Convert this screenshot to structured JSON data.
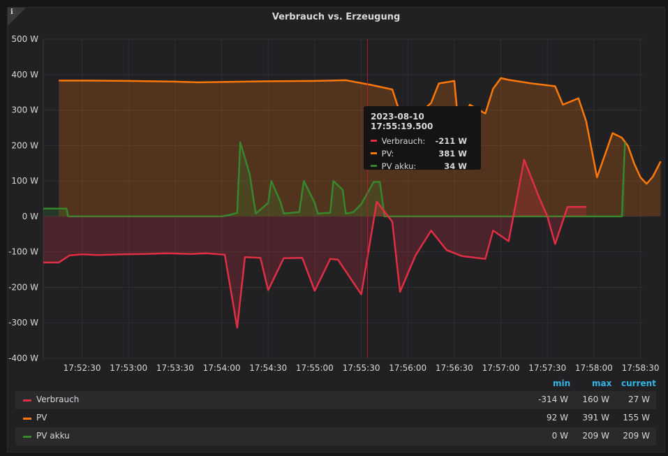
{
  "panel": {
    "info_glyph": "i",
    "title": "Verbrauch vs. Erzeugung"
  },
  "colors": {
    "Verbrauch": "#e02f44",
    "PV": "#ff780a",
    "PV akku": "#37872d",
    "axis_text": "#d8d9da",
    "grid": "#2f2f32",
    "legend_header": "#33b5e5"
  },
  "tooltip": {
    "time": "2023-08-10 17:55:19.500",
    "rows": [
      {
        "name": "Verbrauch:",
        "value": "-211 W",
        "color": "#e02f44"
      },
      {
        "name": "PV:",
        "value": "381 W",
        "color": "#ff780a"
      },
      {
        "name": "PV akku:",
        "value": "34 W",
        "color": "#37872d"
      }
    ]
  },
  "legend": {
    "headers": {
      "min": "min",
      "max": "max",
      "current": "current"
    },
    "rows": [
      {
        "name": "Verbrauch",
        "min": "-314 W",
        "max": "160 W",
        "current": "27 W",
        "color": "#e02f44"
      },
      {
        "name": "PV",
        "min": "92 W",
        "max": "391 W",
        "current": "155 W",
        "color": "#ff780a"
      },
      {
        "name": "PV akku",
        "min": "0 W",
        "max": "209 W",
        "current": "209 W",
        "color": "#37872d"
      }
    ]
  },
  "chart_data": {
    "type": "area",
    "title": "Verbrauch vs. Erzeugung",
    "xlabel": "",
    "ylabel": "",
    "y_unit": "W",
    "ylim": [
      -400,
      500
    ],
    "y_ticks": [
      500,
      400,
      300,
      200,
      100,
      0,
      -100,
      -200,
      -300,
      -400
    ],
    "y_tick_labels": [
      "500 W",
      "400 W",
      "300 W",
      "200 W",
      "100 W",
      "0 W",
      "-100 W",
      "-200 W",
      "-300 W",
      "-400 W"
    ],
    "xlim": [
      "17:52:05",
      "17:58:32"
    ],
    "x_ticks": [
      "17:52:30",
      "17:53:00",
      "17:53:30",
      "17:54:00",
      "17:54:30",
      "17:55:00",
      "17:55:30",
      "17:56:00",
      "17:56:30",
      "17:57:00",
      "17:57:30",
      "17:58:00",
      "17:58:30"
    ],
    "grid": true,
    "crosshair_x": "17:55:34",
    "series": [
      {
        "name": "PV",
        "fill": true,
        "points": [
          [
            "17:52:15",
            383
          ],
          [
            "17:52:35",
            383
          ],
          [
            "17:53:00",
            382
          ],
          [
            "17:53:30",
            380
          ],
          [
            "17:53:45",
            378
          ],
          [
            "17:54:00",
            379
          ],
          [
            "17:54:30",
            381
          ],
          [
            "17:55:00",
            382
          ],
          [
            "17:55:20",
            384
          ],
          [
            "17:55:35",
            372
          ],
          [
            "17:55:50",
            358
          ],
          [
            "17:56:00",
            225
          ],
          [
            "17:56:10",
            300
          ],
          [
            "17:56:15",
            320
          ],
          [
            "17:56:20",
            375
          ],
          [
            "17:56:30",
            382
          ],
          [
            "17:56:33",
            240
          ],
          [
            "17:56:40",
            315
          ],
          [
            "17:56:50",
            290
          ],
          [
            "17:56:55",
            360
          ],
          [
            "17:57:00",
            390
          ],
          [
            "17:57:05",
            385
          ],
          [
            "17:57:20",
            375
          ],
          [
            "17:57:35",
            367
          ],
          [
            "17:57:40",
            315
          ],
          [
            "17:57:50",
            333
          ],
          [
            "17:57:55",
            268
          ],
          [
            "17:58:02",
            110
          ],
          [
            "17:58:12",
            235
          ],
          [
            "17:58:18",
            222
          ],
          [
            "17:58:22",
            198
          ],
          [
            "17:58:26",
            148
          ],
          [
            "17:58:30",
            110
          ],
          [
            "17:58:34",
            92
          ],
          [
            "17:58:38",
            112
          ],
          [
            "17:58:43",
            155
          ]
        ]
      },
      {
        "name": "PV akku",
        "fill": true,
        "points": [
          [
            "17:52:05",
            22
          ],
          [
            "17:52:20",
            22
          ],
          [
            "17:52:21",
            0
          ],
          [
            "17:54:00",
            0
          ],
          [
            "17:54:05",
            4
          ],
          [
            "17:54:10",
            10
          ],
          [
            "17:54:12",
            209
          ],
          [
            "17:54:18",
            120
          ],
          [
            "17:54:22",
            8
          ],
          [
            "17:54:30",
            38
          ],
          [
            "17:54:32",
            100
          ],
          [
            "17:54:38",
            40
          ],
          [
            "17:54:40",
            8
          ],
          [
            "17:54:50",
            12
          ],
          [
            "17:54:53",
            100
          ],
          [
            "17:55:00",
            38
          ],
          [
            "17:55:02",
            8
          ],
          [
            "17:55:10",
            10
          ],
          [
            "17:55:12",
            100
          ],
          [
            "17:55:18",
            75
          ],
          [
            "17:55:20",
            8
          ],
          [
            "17:55:25",
            12
          ],
          [
            "17:55:30",
            35
          ],
          [
            "17:55:38",
            97
          ],
          [
            "17:55:42",
            97
          ],
          [
            "17:55:45",
            0
          ],
          [
            "17:58:18",
            0
          ],
          [
            "17:58:20",
            209
          ]
        ]
      },
      {
        "name": "Verbrauch",
        "fill": true,
        "points": [
          [
            "17:52:05",
            -130
          ],
          [
            "17:52:15",
            -130
          ],
          [
            "17:52:22",
            -110
          ],
          [
            "17:52:30",
            -107
          ],
          [
            "17:52:40",
            -109
          ],
          [
            "17:52:55",
            -107
          ],
          [
            "17:53:10",
            -106
          ],
          [
            "17:53:25",
            -104
          ],
          [
            "17:53:40",
            -106
          ],
          [
            "17:53:50",
            -104
          ],
          [
            "17:54:02",
            -108
          ],
          [
            "17:54:10",
            -314
          ],
          [
            "17:54:15",
            -115
          ],
          [
            "17:54:25",
            -117
          ],
          [
            "17:54:30",
            -208
          ],
          [
            "17:54:40",
            -118
          ],
          [
            "17:54:52",
            -117
          ],
          [
            "17:55:00",
            -210
          ],
          [
            "17:55:10",
            -120
          ],
          [
            "17:55:15",
            -122
          ],
          [
            "17:55:30",
            -220
          ],
          [
            "17:55:40",
            42
          ],
          [
            "17:55:50",
            -15
          ],
          [
            "17:55:55",
            -213
          ],
          [
            "17:56:05",
            -110
          ],
          [
            "17:56:15",
            -40
          ],
          [
            "17:56:25",
            -95
          ],
          [
            "17:56:35",
            -112
          ],
          [
            "17:56:50",
            -120
          ],
          [
            "17:56:55",
            -40
          ],
          [
            "17:57:05",
            -70
          ],
          [
            "17:57:15",
            160
          ],
          [
            "17:57:25",
            50
          ],
          [
            "17:57:30",
            0
          ],
          [
            "17:57:35",
            -78
          ],
          [
            "17:57:43",
            27
          ],
          [
            "17:57:55",
            27
          ]
        ]
      }
    ]
  }
}
